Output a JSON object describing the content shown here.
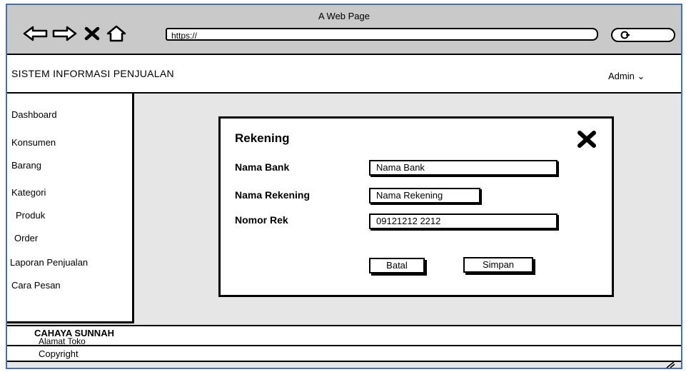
{
  "browser": {
    "title": "A Web Page",
    "url": "https://",
    "icons": [
      "back-arrow-icon",
      "forward-arrow-icon",
      "close-icon",
      "home-icon",
      "search-icon"
    ]
  },
  "header": {
    "app_title": "SISTEM INFORMASI PENJUALAN",
    "user_menu": "Admin ⌄"
  },
  "sidebar": {
    "items": [
      {
        "label": "Dashboard"
      },
      {
        "label": "Konsumen"
      },
      {
        "label": "Barang"
      },
      {
        "label": "Kategori"
      },
      {
        "label": "Produk"
      },
      {
        "label": "Order"
      },
      {
        "label": "Laporan Penjualan"
      },
      {
        "label": "Cara  Pesan"
      }
    ]
  },
  "modal": {
    "title": "Rekening",
    "fields": [
      {
        "label": "Nama Bank",
        "value": "Nama Bank"
      },
      {
        "label": "Nama Rekening",
        "value": "Nama Rekening"
      },
      {
        "label": "Nomor Rek",
        "value": "09121212 2212"
      }
    ],
    "cancel_label": "Batal",
    "save_label": "Simpan"
  },
  "footer": {
    "store_name": "CAHAYA SUNNAH",
    "store_address": "Alamat Toko",
    "copyright": "Copyright"
  },
  "colors": {
    "frame_border": "#4a6fa5",
    "browser_bar": "#c9c9c9",
    "content_bg": "#e6e6e6"
  }
}
